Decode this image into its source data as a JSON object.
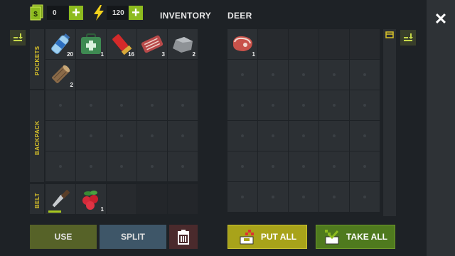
{
  "header": {
    "cash_icon": "cash-stack-icon",
    "cash_value": "0",
    "energy_icon": "lightning-icon",
    "energy_value": "120",
    "plus_label": "+",
    "inventory_title": "INVENTORY",
    "container_title": "DEER",
    "close_label": "✕"
  },
  "inventory": {
    "sections": {
      "pockets": "POCKETS",
      "backpack": "BACKPACK",
      "belt": "BELT"
    },
    "pockets": [
      {
        "item": "water-bottle",
        "qty": "20"
      },
      {
        "item": "first-aid-kit",
        "qty": "1"
      },
      {
        "item": "shotgun-shell",
        "qty": "16"
      },
      {
        "item": "raw-meat",
        "qty": "3"
      },
      {
        "item": "stone",
        "qty": "2"
      },
      {
        "item": "wood-log",
        "qty": "2"
      }
    ],
    "belt": [
      {
        "item": "hunting-knife",
        "qty": ""
      },
      {
        "item": "berries",
        "qty": "1"
      }
    ]
  },
  "container": {
    "items": [
      {
        "item": "deer-meat",
        "qty": "1"
      }
    ]
  },
  "buttons": {
    "use": "USE",
    "split": "SPLIT",
    "put_all": "PUT ALL",
    "take_all": "TAKE ALL"
  },
  "colors": {
    "accent_green": "#8dbb1f",
    "label_yellow": "#d8c22a",
    "put_all": "#a8a31a",
    "take_all": "#4f7a1e"
  }
}
